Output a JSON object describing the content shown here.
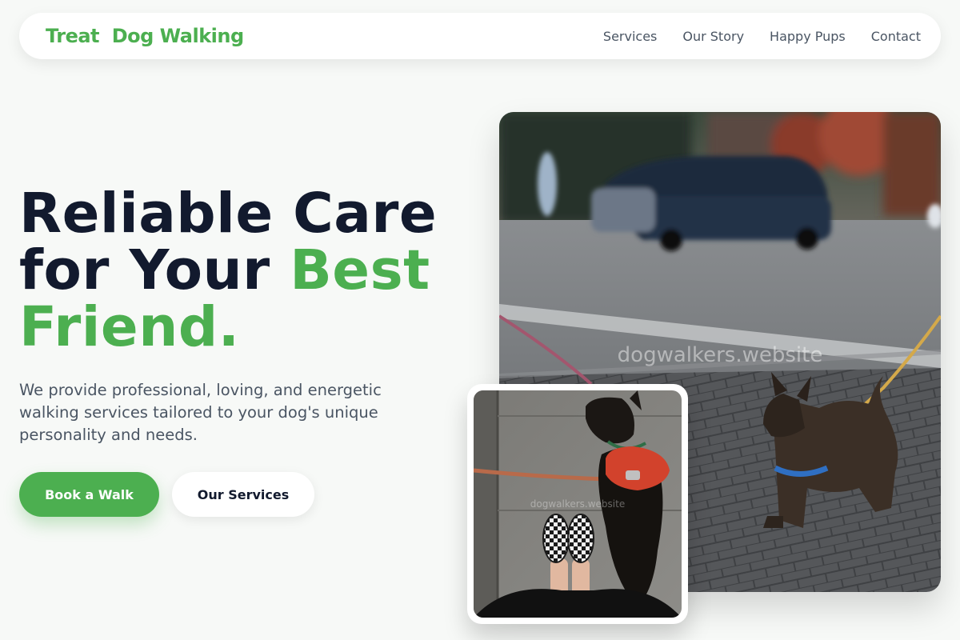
{
  "brand": {
    "name": "Treat  Dog Walking"
  },
  "nav": {
    "links": [
      "Services",
      "Our Story",
      "Happy Pups",
      "Contact"
    ]
  },
  "hero": {
    "headline_line1": "Reliable Care",
    "headline_line2_prefix": "for Your ",
    "headline_line2_accent": "Best",
    "headline_line3_accent": "Friend.",
    "description": "We provide professional, loving, and energetic walking services tailored to your dog's unique personality and needs.",
    "primary_button": "Book a Walk",
    "secondary_button": "Our Services"
  },
  "images": {
    "main_watermark": "dogwalkers.website",
    "small_watermark": "dogwalkers.website",
    "main_icon": "dog-on-leash-street-photo",
    "small_icon": "dog-in-harness-sidewalk-photo"
  },
  "colors": {
    "accent": "#4caf50",
    "heading": "#121a2e",
    "body_text": "#4a5563",
    "background": "#f7f9f7"
  }
}
